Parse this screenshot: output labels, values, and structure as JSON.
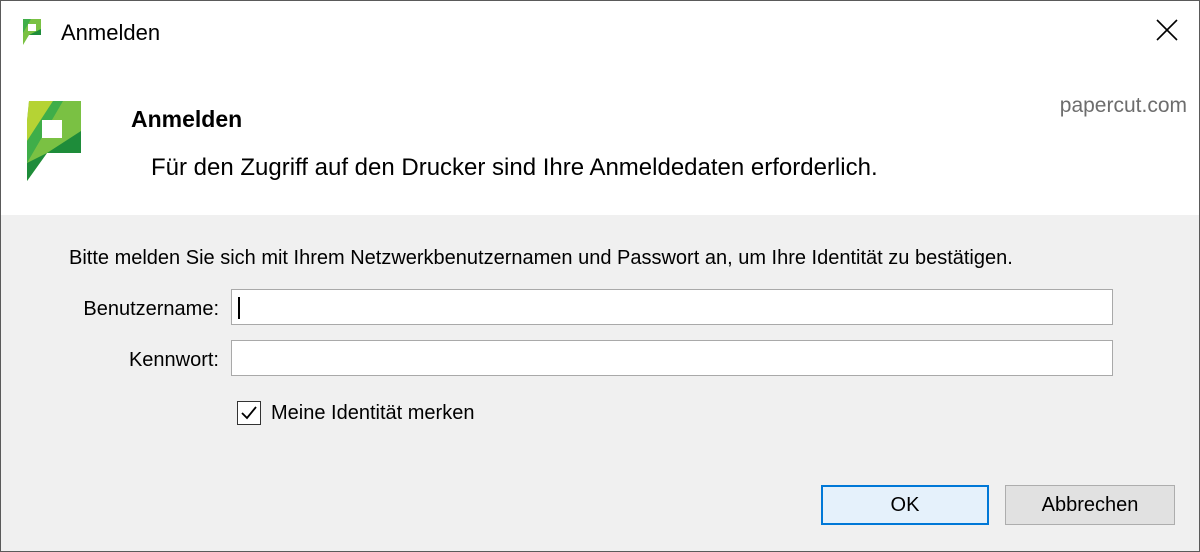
{
  "window": {
    "title": "Anmelden",
    "close_icon": "close-icon"
  },
  "header": {
    "title": "Anmelden",
    "subtitle": "Für den Zugriff auf den Drucker sind Ihre Anmeldedaten erforderlich.",
    "brand_link": "papercut.com",
    "logo_icon": "papercut-logo-icon"
  },
  "form": {
    "instruction": "Bitte melden Sie sich mit Ihrem Netzwerkbenutzernamen und Passwort an, um Ihre Identität zu bestätigen.",
    "username_label": "Benutzername:",
    "username_value": "",
    "password_label": "Kennwort:",
    "password_value": "",
    "remember_label": "Meine Identität merken",
    "remember_checked": true
  },
  "buttons": {
    "ok_label": "OK",
    "cancel_label": "Abbrechen"
  },
  "colors": {
    "brand_green": "#7ac143",
    "brand_dark_green": "#1e8c3a",
    "accent_blue": "#0078d7",
    "body_bg": "#f0f0f0"
  }
}
